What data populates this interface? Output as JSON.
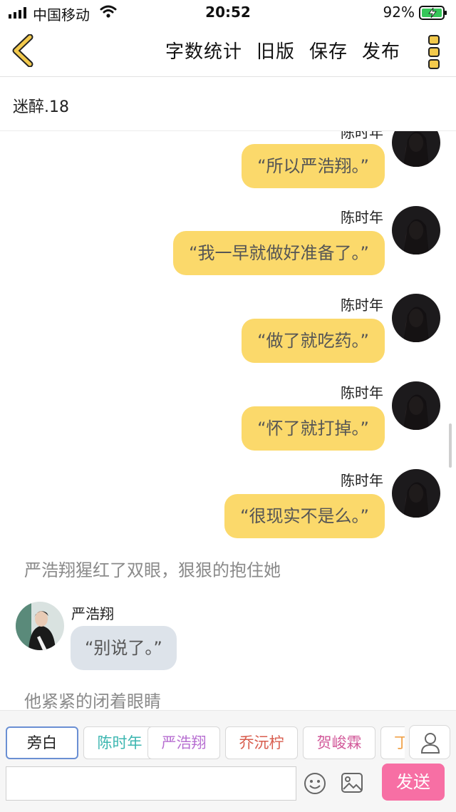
{
  "status_bar": {
    "carrier": "中国移动",
    "time": "20:52",
    "battery": "92%"
  },
  "nav": {
    "actions": [
      "字数统计",
      "旧版",
      "保存",
      "发布"
    ]
  },
  "chapter": {
    "title": "迷醉.18"
  },
  "messages": [
    {
      "side": "right",
      "sender": "陈时年",
      "text": "“所以严浩翔。”"
    },
    {
      "side": "right",
      "sender": "陈时年",
      "text": "“我一早就做好准备了。”"
    },
    {
      "side": "right",
      "sender": "陈时年",
      "text": "“做了就吃药。”"
    },
    {
      "side": "right",
      "sender": "陈时年",
      "text": "“怀了就打掉。”"
    },
    {
      "side": "right",
      "sender": "陈时年",
      "text": "“很现实不是么。”"
    },
    {
      "side": "narration",
      "text": "严浩翔猩红了双眼，狠狠的抱住她"
    },
    {
      "side": "left",
      "sender": "严浩翔",
      "text": "“别说了。”"
    },
    {
      "side": "narration",
      "text": "他紧紧的闭着眼睛"
    }
  ],
  "roles": [
    {
      "name": "旁白",
      "color": "#222222"
    },
    {
      "name": "陈时年",
      "color": "#3bb6b0"
    },
    {
      "name": "严浩翔",
      "color": "#b76fd1"
    },
    {
      "name": "乔沅柠",
      "color": "#d85c4d"
    },
    {
      "name": "贺峻霖",
      "color": "#d25a9a"
    },
    {
      "name": "丁",
      "color": "#f0a24a"
    }
  ],
  "composer": {
    "input_value": "",
    "send_label": "发送"
  },
  "colors": {
    "bubble_right": "#fbd96b",
    "bubble_left": "#dde3ea",
    "send_button": "#f76fa4",
    "accent_icon": "#f2c94c"
  }
}
